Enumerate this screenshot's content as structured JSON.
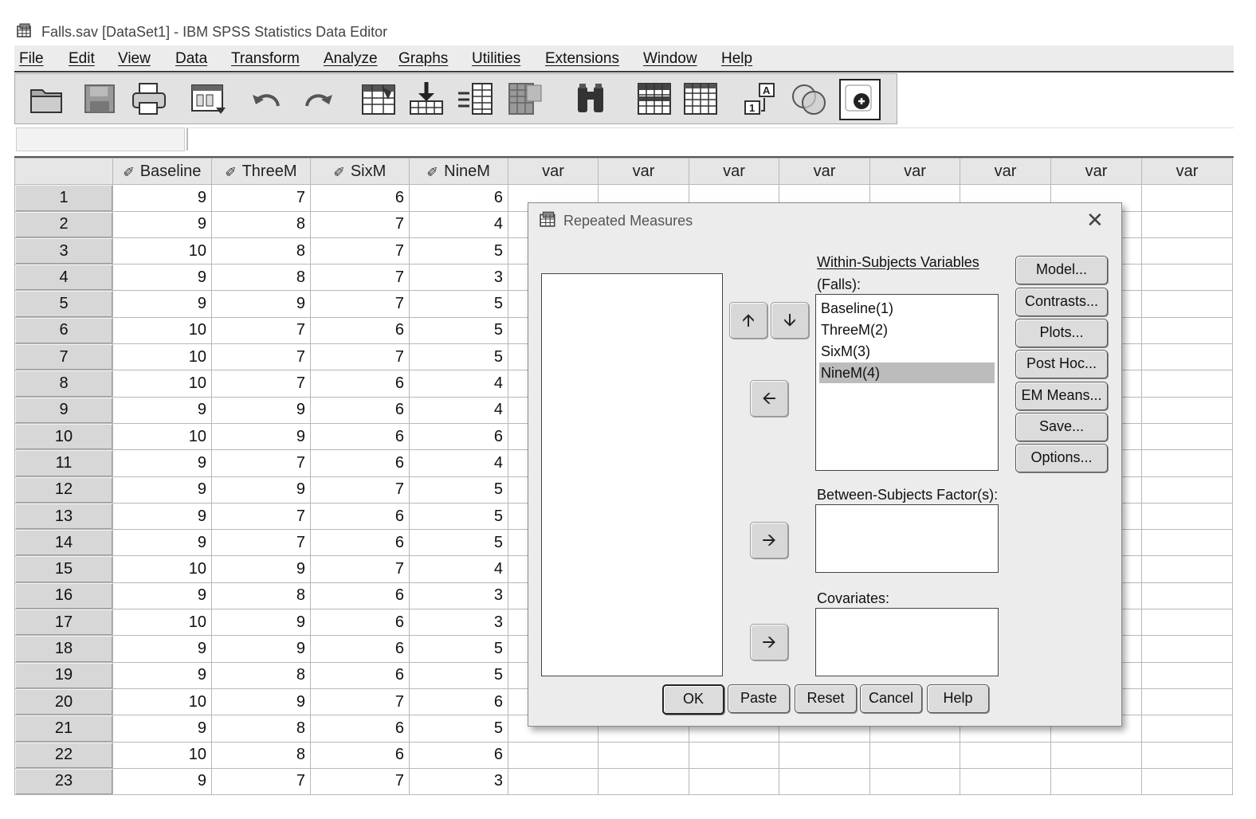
{
  "window": {
    "title": "Falls.sav [DataSet1] - IBM SPSS Statistics Data Editor"
  },
  "menu": [
    "File",
    "Edit",
    "View",
    "Data",
    "Transform",
    "Analyze",
    "Graphs",
    "Utilities",
    "Extensions",
    "Window",
    "Help"
  ],
  "toolbar": {
    "icons": [
      "open-folder-icon",
      "save-icon",
      "print-icon",
      "recall-dialog-icon",
      "undo-icon",
      "redo-icon",
      "goto-case-icon",
      "goto-variable-icon",
      "variables-icon",
      "split-file-icon",
      "find-icon",
      "insert-cases-icon",
      "insert-variable-icon",
      "value-labels-icon",
      "use-sets-icon",
      "spelling-icon"
    ]
  },
  "grid": {
    "columns": [
      "Baseline",
      "ThreeM",
      "SixM",
      "NineM",
      "var",
      "var",
      "var",
      "var",
      "var",
      "var",
      "var",
      "var"
    ],
    "rows": [
      [
        "1",
        "9",
        "7",
        "6",
        "6"
      ],
      [
        "2",
        "9",
        "8",
        "7",
        "4"
      ],
      [
        "3",
        "10",
        "8",
        "7",
        "5"
      ],
      [
        "4",
        "9",
        "8",
        "7",
        "3"
      ],
      [
        "5",
        "9",
        "9",
        "7",
        "5"
      ],
      [
        "6",
        "10",
        "7",
        "6",
        "5"
      ],
      [
        "7",
        "10",
        "7",
        "7",
        "5"
      ],
      [
        "8",
        "10",
        "7",
        "6",
        "4"
      ],
      [
        "9",
        "9",
        "9",
        "6",
        "4"
      ],
      [
        "10",
        "10",
        "9",
        "6",
        "6"
      ],
      [
        "11",
        "9",
        "7",
        "6",
        "4"
      ],
      [
        "12",
        "9",
        "9",
        "7",
        "5"
      ],
      [
        "13",
        "9",
        "7",
        "6",
        "5"
      ],
      [
        "14",
        "9",
        "7",
        "6",
        "5"
      ],
      [
        "15",
        "10",
        "9",
        "7",
        "4"
      ],
      [
        "16",
        "9",
        "8",
        "6",
        "3"
      ],
      [
        "17",
        "10",
        "9",
        "6",
        "3"
      ],
      [
        "18",
        "9",
        "9",
        "6",
        "5"
      ],
      [
        "19",
        "9",
        "8",
        "6",
        "5"
      ],
      [
        "20",
        "10",
        "9",
        "7",
        "6"
      ],
      [
        "21",
        "9",
        "8",
        "6",
        "5"
      ],
      [
        "22",
        "10",
        "8",
        "6",
        "6"
      ],
      [
        "23",
        "9",
        "7",
        "7",
        "3"
      ]
    ]
  },
  "dialog": {
    "title": "Repeated Measures",
    "within_label": "Within-Subjects Variables",
    "within_factor": "(Falls):",
    "within_items": [
      "Baseline(1)",
      "ThreeM(2)",
      "SixM(3)",
      "NineM(4)"
    ],
    "selected_item": "NineM(4)",
    "between_label": "Between-Subjects Factor(s):",
    "covariates_label": "Covariates:",
    "side_buttons": [
      "Model...",
      "Contrasts...",
      "Plots...",
      "Post Hoc...",
      "EM Means...",
      "Save...",
      "Options..."
    ],
    "bottom_buttons": [
      "OK",
      "Paste",
      "Reset",
      "Cancel",
      "Help"
    ]
  }
}
